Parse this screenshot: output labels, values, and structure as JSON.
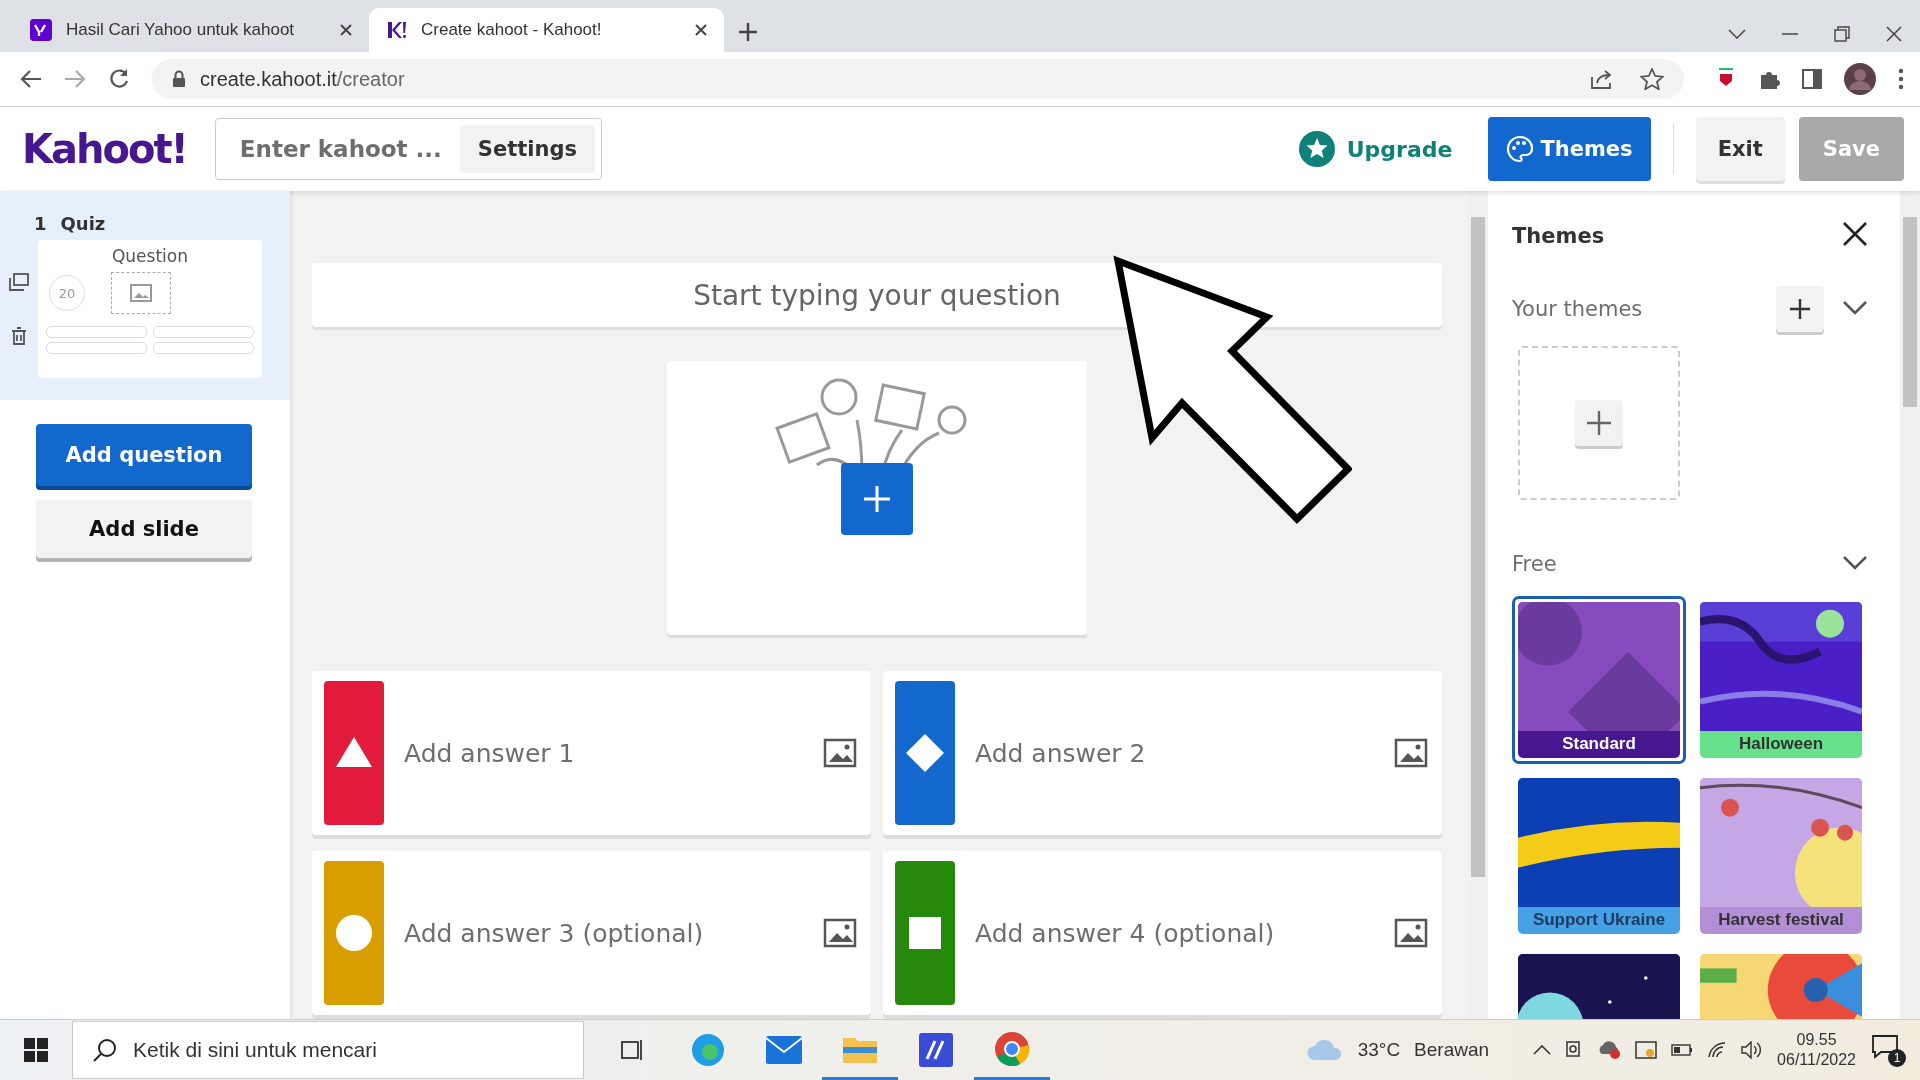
{
  "browser": {
    "tabs": [
      {
        "title": "Hasil Cari Yahoo untuk kahoot",
        "kind": "yahoo",
        "selected": false
      },
      {
        "title": "Create kahoot - Kahoot!",
        "kind": "kahoot",
        "selected": true
      }
    ],
    "url": {
      "host": "create.kahoot.it",
      "path": "/creator"
    }
  },
  "header": {
    "logo": "Kahoot!",
    "title_placeholder": "Enter kahoot ...",
    "settings": "Settings",
    "upgrade": "Upgrade",
    "themes": "Themes",
    "exit": "Exit",
    "save": {
      "label": "Save",
      "disabled": true
    }
  },
  "sidebar": {
    "slides": [
      {
        "number": "1",
        "type": "Quiz",
        "title": "Question",
        "timer": "20",
        "selected": true
      }
    ],
    "add_question": "Add question",
    "add_slide": "Add slide"
  },
  "editor": {
    "question_placeholder": "Start typing your question",
    "answers": [
      {
        "placeholder": "Add answer 1",
        "kind": "triangle",
        "color": "#e21b3c"
      },
      {
        "placeholder": "Add answer 2",
        "kind": "diamond",
        "color": "#1368ce"
      },
      {
        "placeholder": "Add answer 3 (optional)",
        "kind": "circle",
        "color": "#d89e00"
      },
      {
        "placeholder": "Add answer 4 (optional)",
        "kind": "square",
        "color": "#26890c"
      }
    ]
  },
  "themes_panel": {
    "title": "Themes",
    "your_themes": "Your themes",
    "free": "Free",
    "themes": [
      {
        "name": "Standard",
        "kind": "standard",
        "selected": true
      },
      {
        "name": "Halloween",
        "kind": "halloween",
        "selected": false
      },
      {
        "name": "Support Ukraine",
        "kind": "ukraine",
        "selected": false
      },
      {
        "name": "Harvest festival",
        "kind": "harvest",
        "selected": false
      },
      {
        "kind": "space",
        "selected": false
      },
      {
        "kind": "beach",
        "selected": false
      }
    ]
  },
  "taskbar": {
    "search_placeholder": "Ketik di sini untuk mencari",
    "temperature": "33°C",
    "weather": "Berawan",
    "time": "09.55",
    "date": "06/11/2022",
    "notifications": "1"
  }
}
